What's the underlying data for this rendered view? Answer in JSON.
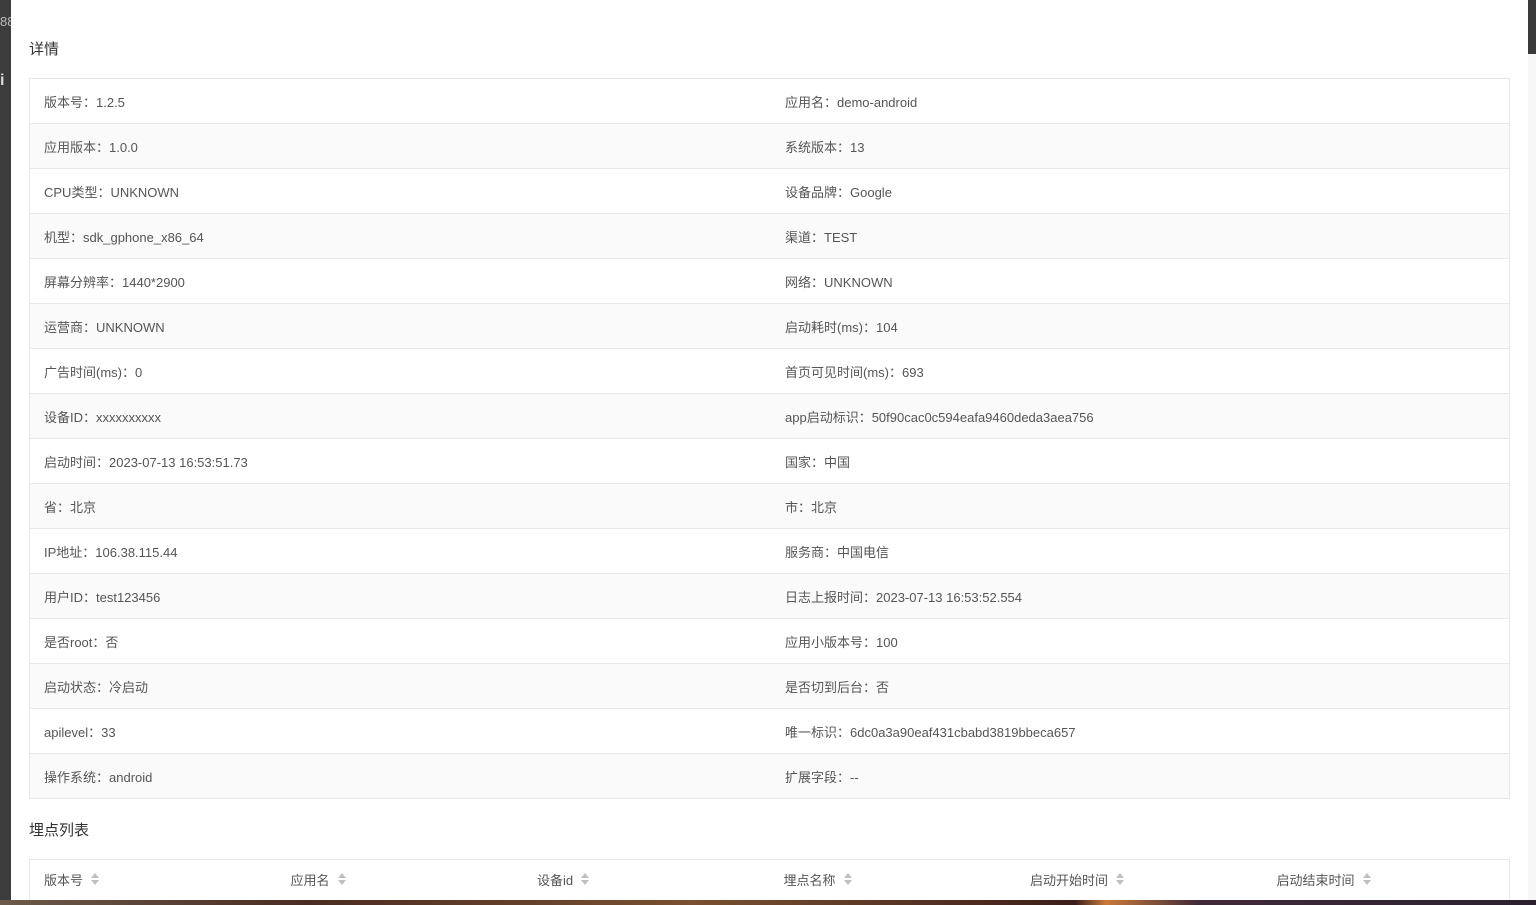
{
  "background": {
    "left_glyphs": [
      "88",
      "i"
    ]
  },
  "modal": {
    "details_title": "详情",
    "details": [
      [
        "版本号：1.2.5",
        "应用名：demo-android"
      ],
      [
        "应用版本：1.0.0",
        "系统版本：13"
      ],
      [
        "CPU类型：UNKNOWN",
        "设备品牌：Google"
      ],
      [
        "机型：sdk_gphone_x86_64",
        "渠道：TEST"
      ],
      [
        "屏幕分辨率：1440*2900",
        "网络：UNKNOWN"
      ],
      [
        "运营商：UNKNOWN",
        "启动耗时(ms)：104"
      ],
      [
        "广告时间(ms)：0",
        "首页可见时间(ms)：693"
      ],
      [
        "设备ID：xxxxxxxxxx",
        "app启动标识：50f90cac0c594eafa9460deda3aea756"
      ],
      [
        "启动时间：2023-07-13 16:53:51.73",
        "国家：中国"
      ],
      [
        "省：北京",
        "市：北京"
      ],
      [
        "IP地址：106.38.115.44",
        "服务商：中国电信"
      ],
      [
        "用户ID：test123456",
        "日志上报时间：2023-07-13 16:53:52.554"
      ],
      [
        "是否root：否",
        "应用小版本号：100"
      ],
      [
        "启动状态：冷启动",
        "是否切到后台：否"
      ],
      [
        "apilevel：33",
        "唯一标识：6dc0a3a90eaf431cbabd3819bbeca657"
      ],
      [
        "操作系统：android",
        "扩展字段：--"
      ]
    ],
    "list_title": "埋点列表",
    "list_columns": [
      "版本号",
      "应用名",
      "设备id",
      "埋点名称",
      "启动开始时间",
      "启动结束时间"
    ]
  },
  "colors": {
    "border": "#e8e8e8",
    "stripe": "#fafafa",
    "text": "#555555",
    "sorter": "#bfbfbf"
  }
}
